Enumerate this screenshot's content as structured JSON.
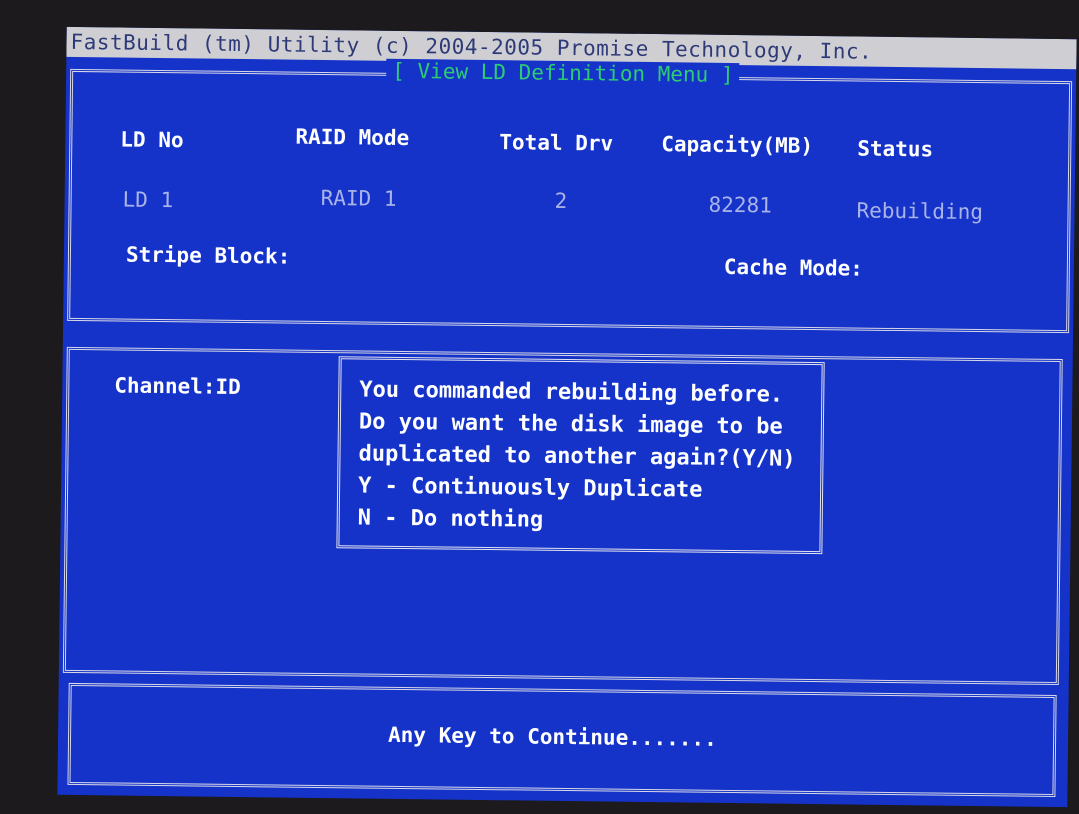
{
  "app_title": "FastBuild (tm) Utility (c) 2004-2005 Promise Technology, Inc.",
  "menu_title": "[ View LD Definition Menu ]",
  "ld_table": {
    "headers": {
      "ld_no": "LD No",
      "raid_mode": "RAID Mode",
      "total_drv": "Total Drv",
      "capacity": "Capacity(MB)",
      "status": "Status"
    },
    "row": {
      "ld_no": "LD  1",
      "raid_mode": "RAID 1",
      "total_drv": "2",
      "capacity": "82281",
      "status": "Rebuilding"
    },
    "stripe_block_label": "Stripe Block:",
    "cache_mode_label": "Cache Mode:"
  },
  "channel_label": "Channel:ID",
  "dialog": {
    "lines": [
      "You commanded rebuilding before.",
      "Do you want the disk image to be",
      "duplicated to another again?(Y/N)",
      "Y - Continuously Duplicate",
      "N - Do nothing"
    ]
  },
  "footer": {
    "prompt": "Any Key to Continue......."
  }
}
